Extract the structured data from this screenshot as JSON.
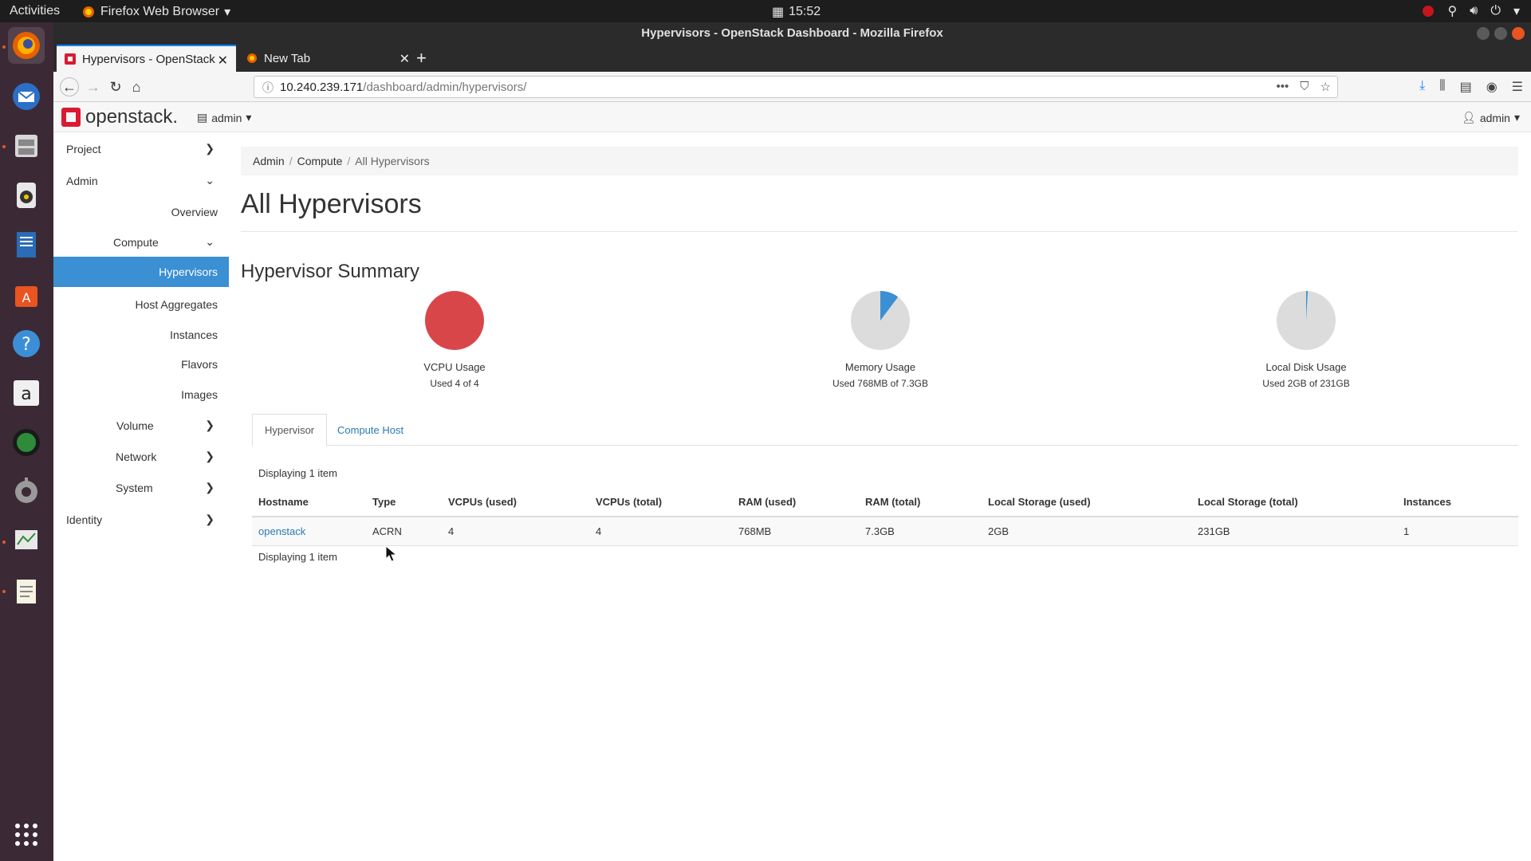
{
  "topbar": {
    "activities": "Activities",
    "app_menu": "Firefox Web Browser",
    "clock": "15:52"
  },
  "window": {
    "title": "Hypervisors - OpenStack Dashboard - Mozilla Firefox"
  },
  "tabs": [
    {
      "label": "Hypervisors - OpenStack",
      "active": true
    },
    {
      "label": "New Tab",
      "active": false
    }
  ],
  "navbar": {
    "url_host": "10.240.239.171",
    "url_path": "/dashboard/admin/hypervisors/"
  },
  "os_header": {
    "brand": "openstack.",
    "project": "admin",
    "user": "admin"
  },
  "sidebar": {
    "items": [
      {
        "label": "Project"
      },
      {
        "label": "Admin"
      },
      {
        "label": "Overview"
      },
      {
        "label": "Compute"
      },
      {
        "label": "Hypervisors"
      },
      {
        "label": "Host Aggregates"
      },
      {
        "label": "Instances"
      },
      {
        "label": "Flavors"
      },
      {
        "label": "Images"
      },
      {
        "label": "Volume"
      },
      {
        "label": "Network"
      },
      {
        "label": "System"
      },
      {
        "label": "Identity"
      }
    ]
  },
  "breadcrumb": [
    "Admin",
    "Compute",
    "All Hypervisors"
  ],
  "page": {
    "title": "All Hypervisors",
    "summary_title": "Hypervisor Summary"
  },
  "summary": [
    {
      "label": "VCPU Usage",
      "sub": "Used 4 of 4",
      "fraction": 1.0
    },
    {
      "label": "Memory Usage",
      "sub": "Used 768MB of 7.3GB",
      "fraction": 0.1027
    },
    {
      "label": "Local Disk Usage",
      "sub": "Used 2GB of 231GB",
      "fraction": 0.0087
    }
  ],
  "colors": {
    "pie_full": "#d9464a",
    "pie_used": "#3b8fd3",
    "pie_free": "#dcdcdc",
    "sidebar_active": "#3b8fd3",
    "link": "#2a7ab0"
  },
  "subtabs": {
    "hypervisor": "Hypervisor",
    "compute_host": "Compute Host"
  },
  "table": {
    "display_count": "Displaying 1 item",
    "columns": [
      "Hostname",
      "Type",
      "VCPUs (used)",
      "VCPUs (total)",
      "RAM (used)",
      "RAM (total)",
      "Local Storage (used)",
      "Local Storage (total)",
      "Instances"
    ],
    "rows": [
      [
        "openstack",
        "ACRN",
        "4",
        "4",
        "768MB",
        "7.3GB",
        "2GB",
        "231GB",
        "1"
      ]
    ]
  }
}
